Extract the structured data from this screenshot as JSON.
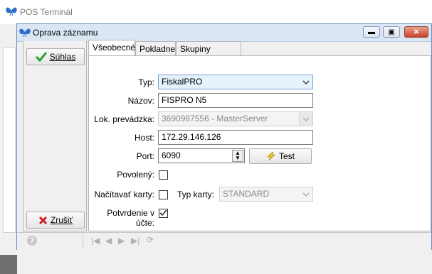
{
  "bg_window": {
    "title": "POS Terminál"
  },
  "dialog": {
    "title": "Oprava záznamu",
    "ok_label": "Súhlas",
    "cancel_label": "Zrušiť"
  },
  "tabs": [
    "Všeobecné",
    "Pokladne",
    "Skupiny pokladní"
  ],
  "form": {
    "type_label": "Typ:",
    "type_value": "FiskalPRO",
    "name_label": "Názov:",
    "name_value": "FISPRO N5",
    "branch_label": "Lok. prevádzka:",
    "branch_value": "3690987556 - MasterServer",
    "host_label": "Host:",
    "host_value": "172.29.146.126",
    "port_label": "Port:",
    "port_value": "6090",
    "test_label": "Test",
    "enabled_label": "Povolený:",
    "enabled_checked": false,
    "read_cards_label": "Načítavať karty:",
    "read_cards_checked": false,
    "card_type_label": "Typ karty:",
    "card_type_value": "STANDARD",
    "receipt_confirm_label": "Potvrdenie v účte:",
    "receipt_confirm_checked": true
  },
  "colors": {
    "accent": "#0078d7",
    "ok_check": "#2ea02e",
    "cancel_x": "#d02020",
    "title_bar": "#dbe6f4"
  },
  "icons": {
    "app": "butterfly-icon",
    "ok": "check-icon",
    "cancel": "x-icon",
    "test": "lightning-icon",
    "help": "question-icon"
  }
}
